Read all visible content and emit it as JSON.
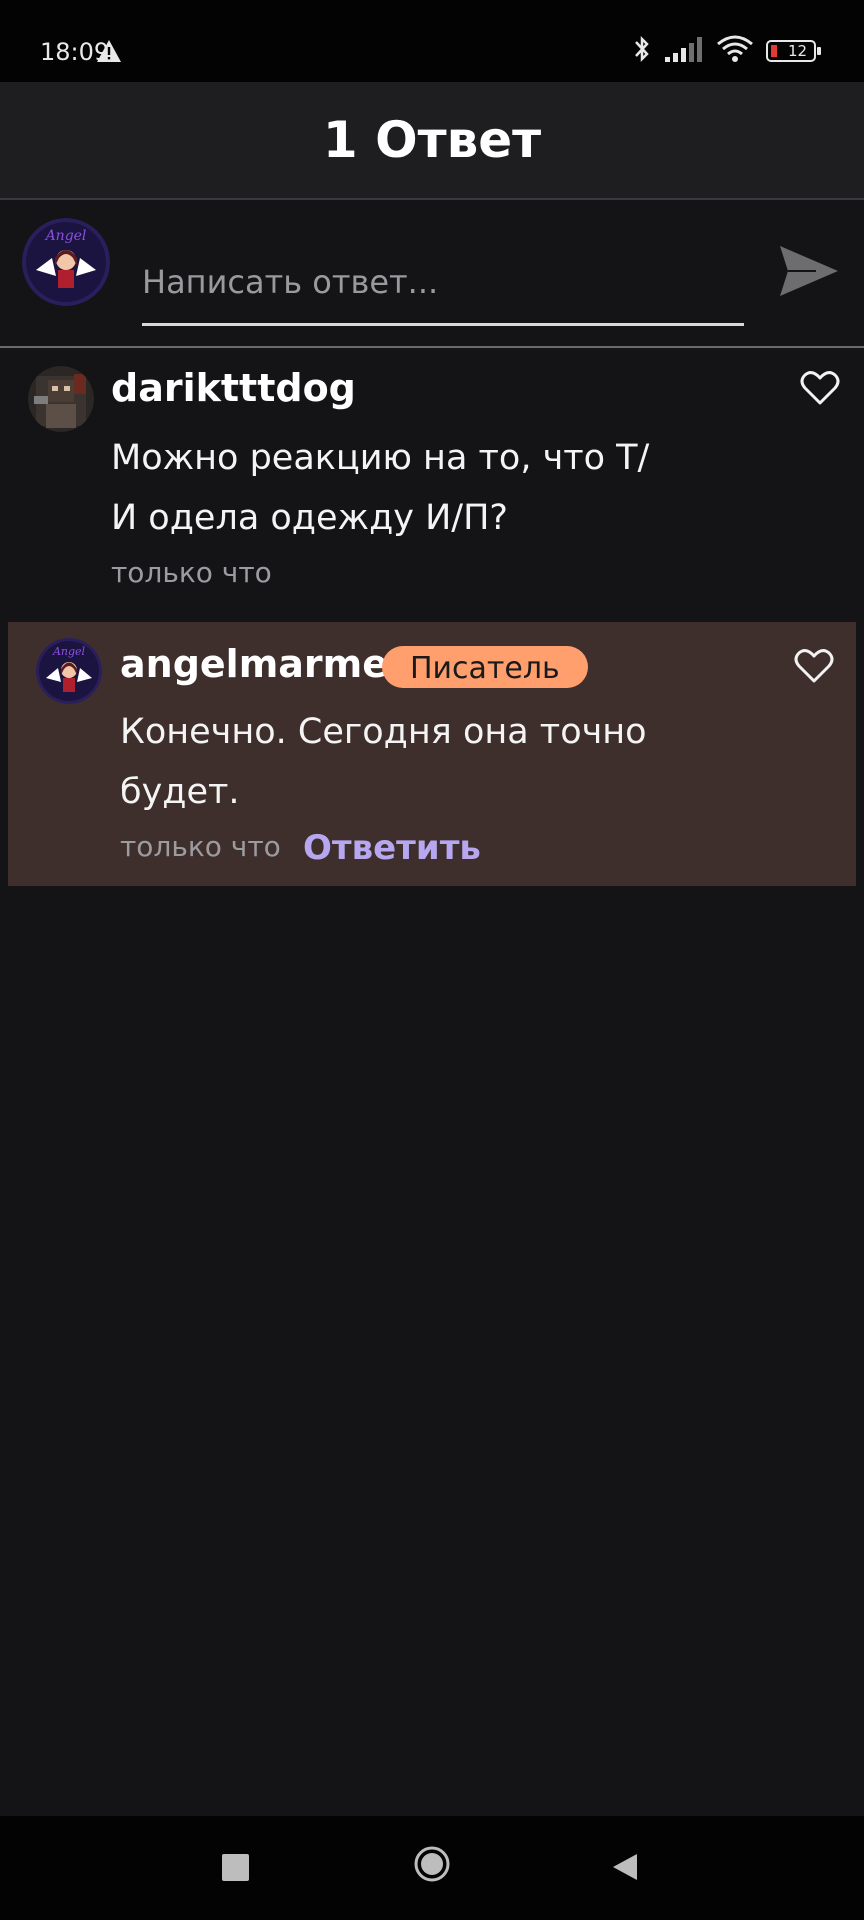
{
  "status_bar": {
    "time": "18:09",
    "battery": "12",
    "icons": [
      "warning-icon",
      "bluetooth-icon",
      "signal-icon",
      "wifi-icon",
      "battery-icon"
    ]
  },
  "header": {
    "title": "1 Ответ"
  },
  "reply_bar": {
    "placeholder": "Написать ответ...",
    "send_icon": "send-icon"
  },
  "comments": [
    {
      "username": "dariktttdog",
      "text": "Можно реакцию на то, что Т/И одела одежду И/П?",
      "time": "только что",
      "like_icon": "heart-outline-icon"
    },
    {
      "username": "angelmarmer",
      "badge": "Писатель",
      "text": "Конечно. Сегодня она точно будет.",
      "time": "только что",
      "reply_label": "Ответить",
      "like_icon": "heart-outline-icon"
    }
  ],
  "nav_bar": {
    "icons": [
      "recent-apps-icon",
      "home-icon",
      "back-icon"
    ]
  },
  "colors": {
    "background": "#141316",
    "header": "#1e1d20",
    "highlight_comment": "#3e2f2c",
    "badge": "#ff9f6e",
    "reply_link": "#b6a7f0"
  }
}
